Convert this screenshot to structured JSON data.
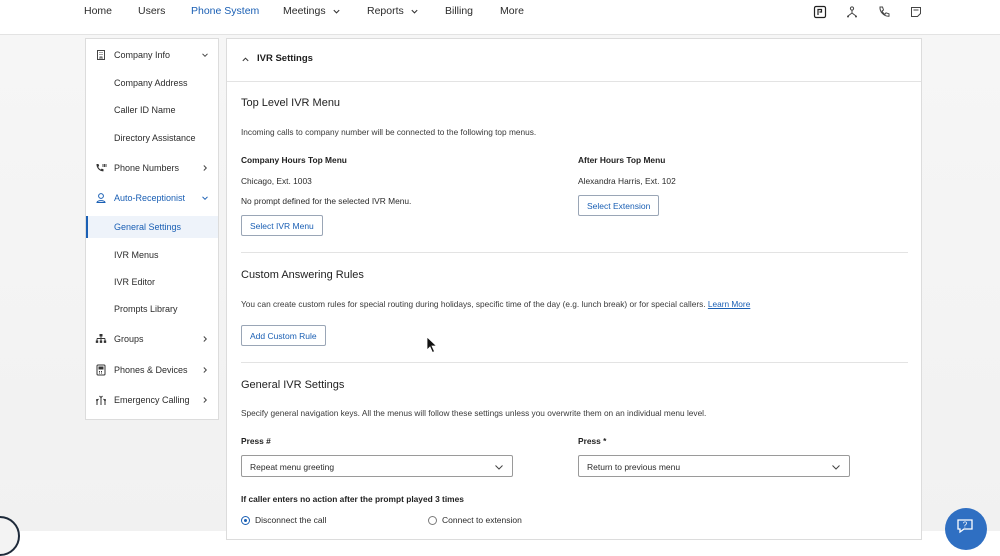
{
  "topnav": {
    "items": [
      {
        "label": "Home",
        "active": false
      },
      {
        "label": "Users",
        "active": false
      },
      {
        "label": "Phone System",
        "active": true
      },
      {
        "label": "Meetings",
        "active": false,
        "dropdown": true
      },
      {
        "label": "Reports",
        "active": false,
        "dropdown": true
      },
      {
        "label": "Billing",
        "active": false
      },
      {
        "label": "More",
        "active": false
      }
    ],
    "icons": [
      "app-logo-icon",
      "org-chart-icon",
      "phone-icon",
      "notes-icon"
    ]
  },
  "sidebar": {
    "company_info": "Company Info",
    "company_address": "Company Address",
    "caller_id_name": "Caller ID Name",
    "directory_assistance": "Directory Assistance",
    "phone_numbers": "Phone Numbers",
    "auto_receptionist": "Auto-Receptionist",
    "general_settings": "General Settings",
    "ivr_menus": "IVR Menus",
    "ivr_editor": "IVR Editor",
    "prompts_library": "Prompts Library",
    "groups": "Groups",
    "phones_devices": "Phones & Devices",
    "emergency_calling": "Emergency Calling"
  },
  "main": {
    "header_title": "IVR Settings",
    "top_level": {
      "title": "Top Level IVR Menu",
      "description": "Incoming calls to company number will be connected to the following top menus.",
      "company_hours_label": "Company Hours Top Menu",
      "company_hours_value": "Chicago, Ext. 1003",
      "no_prompt": "No prompt defined for the selected IVR Menu.",
      "select_ivr_button": "Select IVR Menu",
      "after_hours_label": "After Hours Top Menu",
      "after_hours_value": "Alexandra Harris, Ext. 102",
      "select_extension_button": "Select Extension"
    },
    "custom_rules": {
      "title": "Custom Answering Rules",
      "description": "You can create custom rules for special routing during holidays, specific time of the day (e.g. lunch break) or for special callers.",
      "learn_more": "Learn More",
      "add_button": "Add Custom Rule"
    },
    "general_ivr": {
      "title": "General IVR Settings",
      "description": "Specify general navigation keys. All the menus will follow these settings unless you overwrite them on an individual menu level.",
      "press_hash_label": "Press #",
      "press_hash_value": "Repeat menu greeting",
      "press_star_label": "Press *",
      "press_star_value": "Return to previous menu",
      "no_action_label": "If caller enters no action after the prompt played 3 times",
      "radio_disconnect": "Disconnect the call",
      "radio_connect_ext": "Connect to extension"
    }
  },
  "colors": {
    "accent": "#1a5fb4",
    "help_button": "#2f6fc2"
  }
}
